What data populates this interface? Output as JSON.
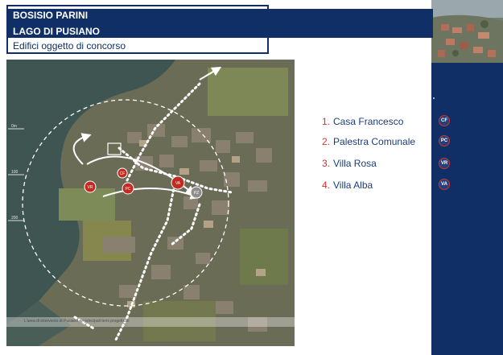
{
  "header": {
    "title_line1": "BOSISIO PARINI",
    "title_line2": "LAGO DI PUSIANO",
    "subtitle": "Edifici oggetto di concorso"
  },
  "map": {
    "scale_labels": [
      "0m",
      "100",
      "200"
    ],
    "markers": [
      {
        "code": "VR"
      },
      {
        "code": "CF"
      },
      {
        "code": "PC"
      },
      {
        "code": "VA"
      },
      {
        "code": "PZ"
      }
    ],
    "caption": "L'area di intervento di Pusiano e i principali temi progettuali"
  },
  "legend": [
    {
      "num": "1.",
      "label": "Casa Francesco",
      "code": "CF"
    },
    {
      "num": "2.",
      "label": "Palestra Comunale",
      "code": "PC"
    },
    {
      "num": "3.",
      "label": "Villa Rosa",
      "code": "VR"
    },
    {
      "num": "4.",
      "label": "Villa Alba",
      "code": "VA"
    }
  ],
  "colors": {
    "navy": "#0f2f66",
    "accent_red": "#d0342c",
    "text_blue": "#1c3d78"
  },
  "icons": {
    "corner": "aerial-photo",
    "map": "satellite-map"
  }
}
